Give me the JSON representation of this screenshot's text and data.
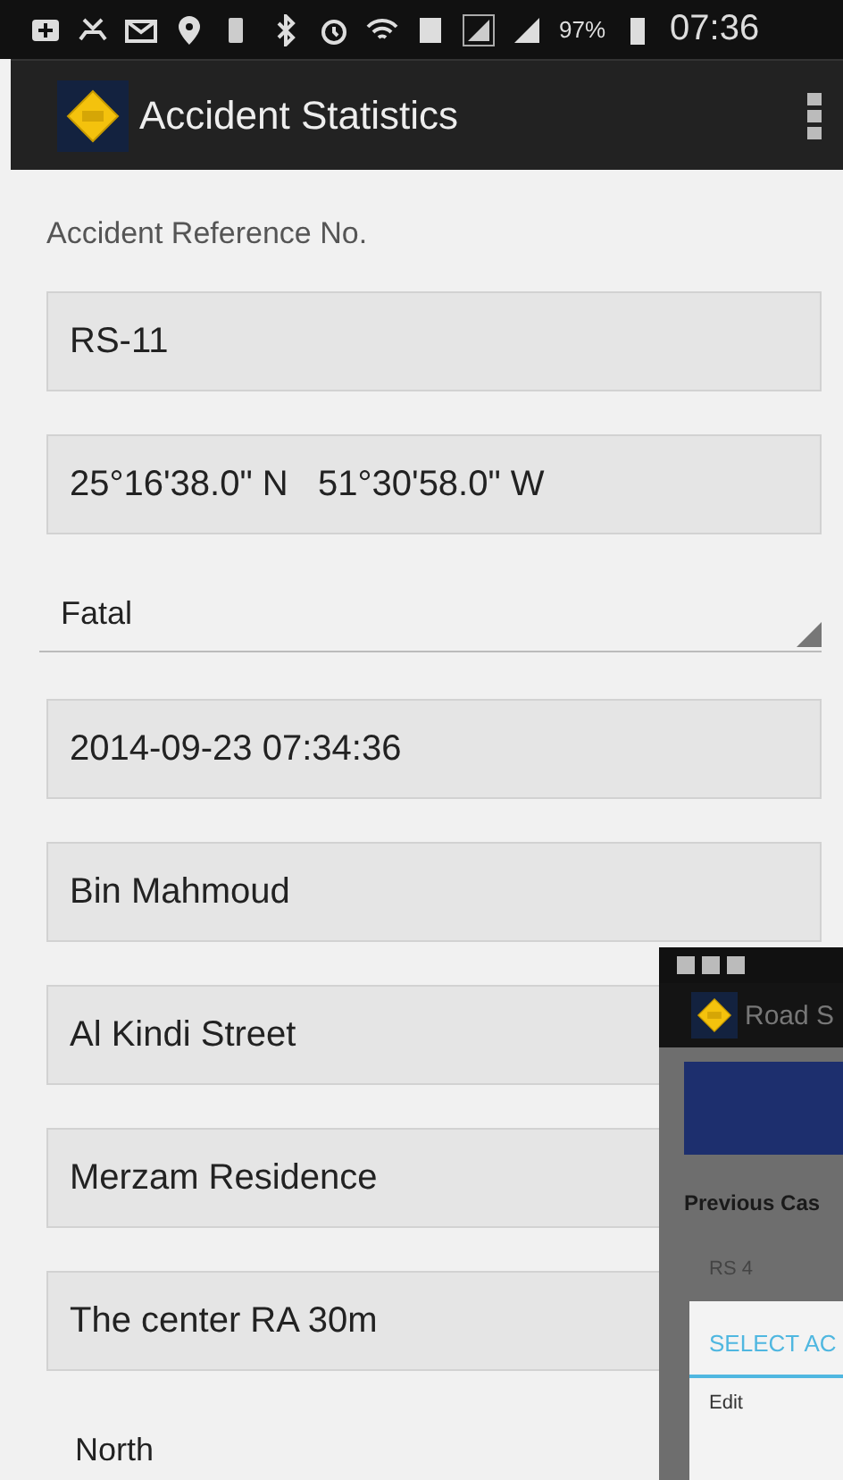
{
  "status_bar": {
    "battery": "97%",
    "time": "07:36"
  },
  "app_bar": {
    "title": "Accident Statistics"
  },
  "form": {
    "label": "Accident Reference No.",
    "fields": [
      {
        "kind": "field",
        "value": "RS-11"
      },
      {
        "kind": "field",
        "value": "25°16'38.0\" N   51°30'58.0\" W"
      },
      {
        "kind": "spinner",
        "value": "Fatal"
      },
      {
        "kind": "field",
        "value": "2014-09-23 07:34:36"
      },
      {
        "kind": "field",
        "value": "Bin Mahmoud"
      },
      {
        "kind": "field",
        "value": "Al Kindi Street"
      },
      {
        "kind": "field",
        "value": "Merzam Residence"
      },
      {
        "kind": "field",
        "value": "The center RA 30m"
      },
      {
        "kind": "text",
        "value": "North"
      }
    ]
  },
  "overlay_window": {
    "app_title": "Road S",
    "heading": "Previous Cas",
    "case": "RS 4",
    "dialog": {
      "title": "SELECT AC",
      "items": [
        "Edit"
      ]
    }
  }
}
